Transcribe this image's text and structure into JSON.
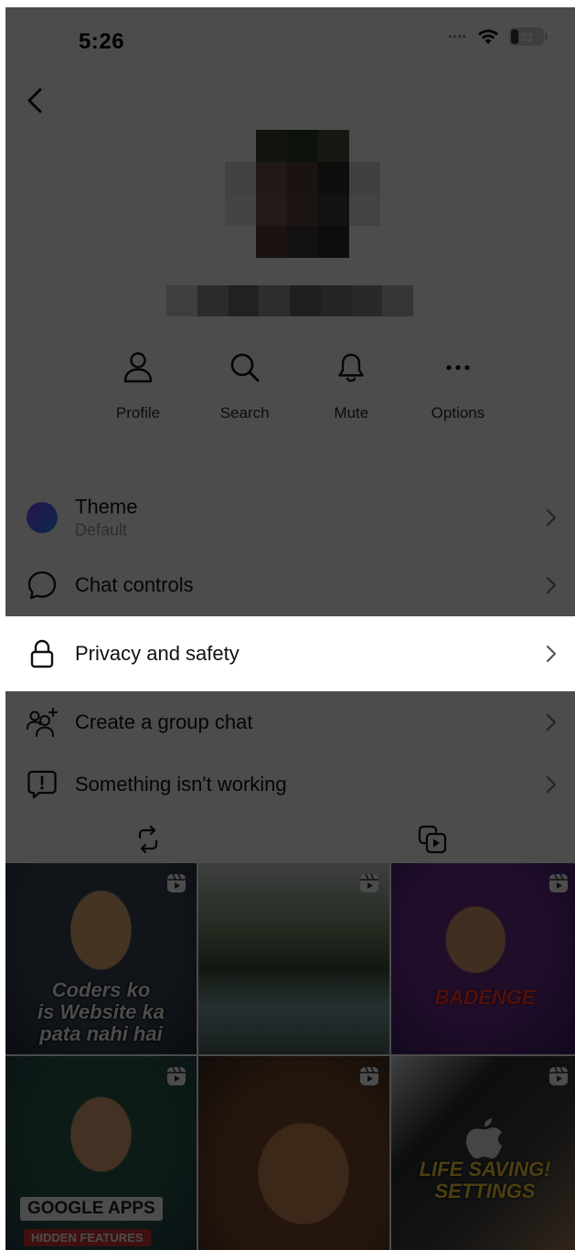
{
  "status_bar": {
    "time": "5:26",
    "battery": "23",
    "battery_level": 0.23
  },
  "header": {
    "back_icon": "chevron-left-icon"
  },
  "actions": [
    {
      "label": "Profile",
      "icon": "person-icon"
    },
    {
      "label": "Search",
      "icon": "search-icon"
    },
    {
      "label": "Mute",
      "icon": "bell-icon"
    },
    {
      "label": "Options",
      "icon": "more-horizontal-icon"
    }
  ],
  "settings": {
    "theme": {
      "title": "Theme",
      "subtitle": "Default"
    },
    "chat_controls": {
      "title": "Chat controls"
    },
    "privacy": {
      "title": "Privacy and safety"
    },
    "group_chat": {
      "title": "Create a group chat"
    },
    "report": {
      "title": "Something isn't working"
    }
  },
  "media_tabs": [
    {
      "icon": "repost-icon"
    },
    {
      "icon": "reels-icon"
    }
  ],
  "grid": {
    "tile_1": {
      "caption_1": "Coders ko",
      "caption_2": "is Website ka",
      "caption_3": "pata nahi hai"
    },
    "tile_3": {
      "caption": "BADENGE"
    },
    "tile_4": {
      "caption_1": "GOOGLE APPS",
      "caption_2": "HIDDEN FEATURES"
    },
    "tile_6": {
      "caption_1": "LIFE SAVING!",
      "caption_2": "SETTINGS"
    }
  },
  "colors": {
    "overlay": "#000000",
    "highlight": "#ffffff",
    "theme_dot_start": "#7b4dff",
    "theme_dot_end": "#2e8bff",
    "text_primary": "#111111",
    "text_secondary": "#9a9a9a"
  }
}
